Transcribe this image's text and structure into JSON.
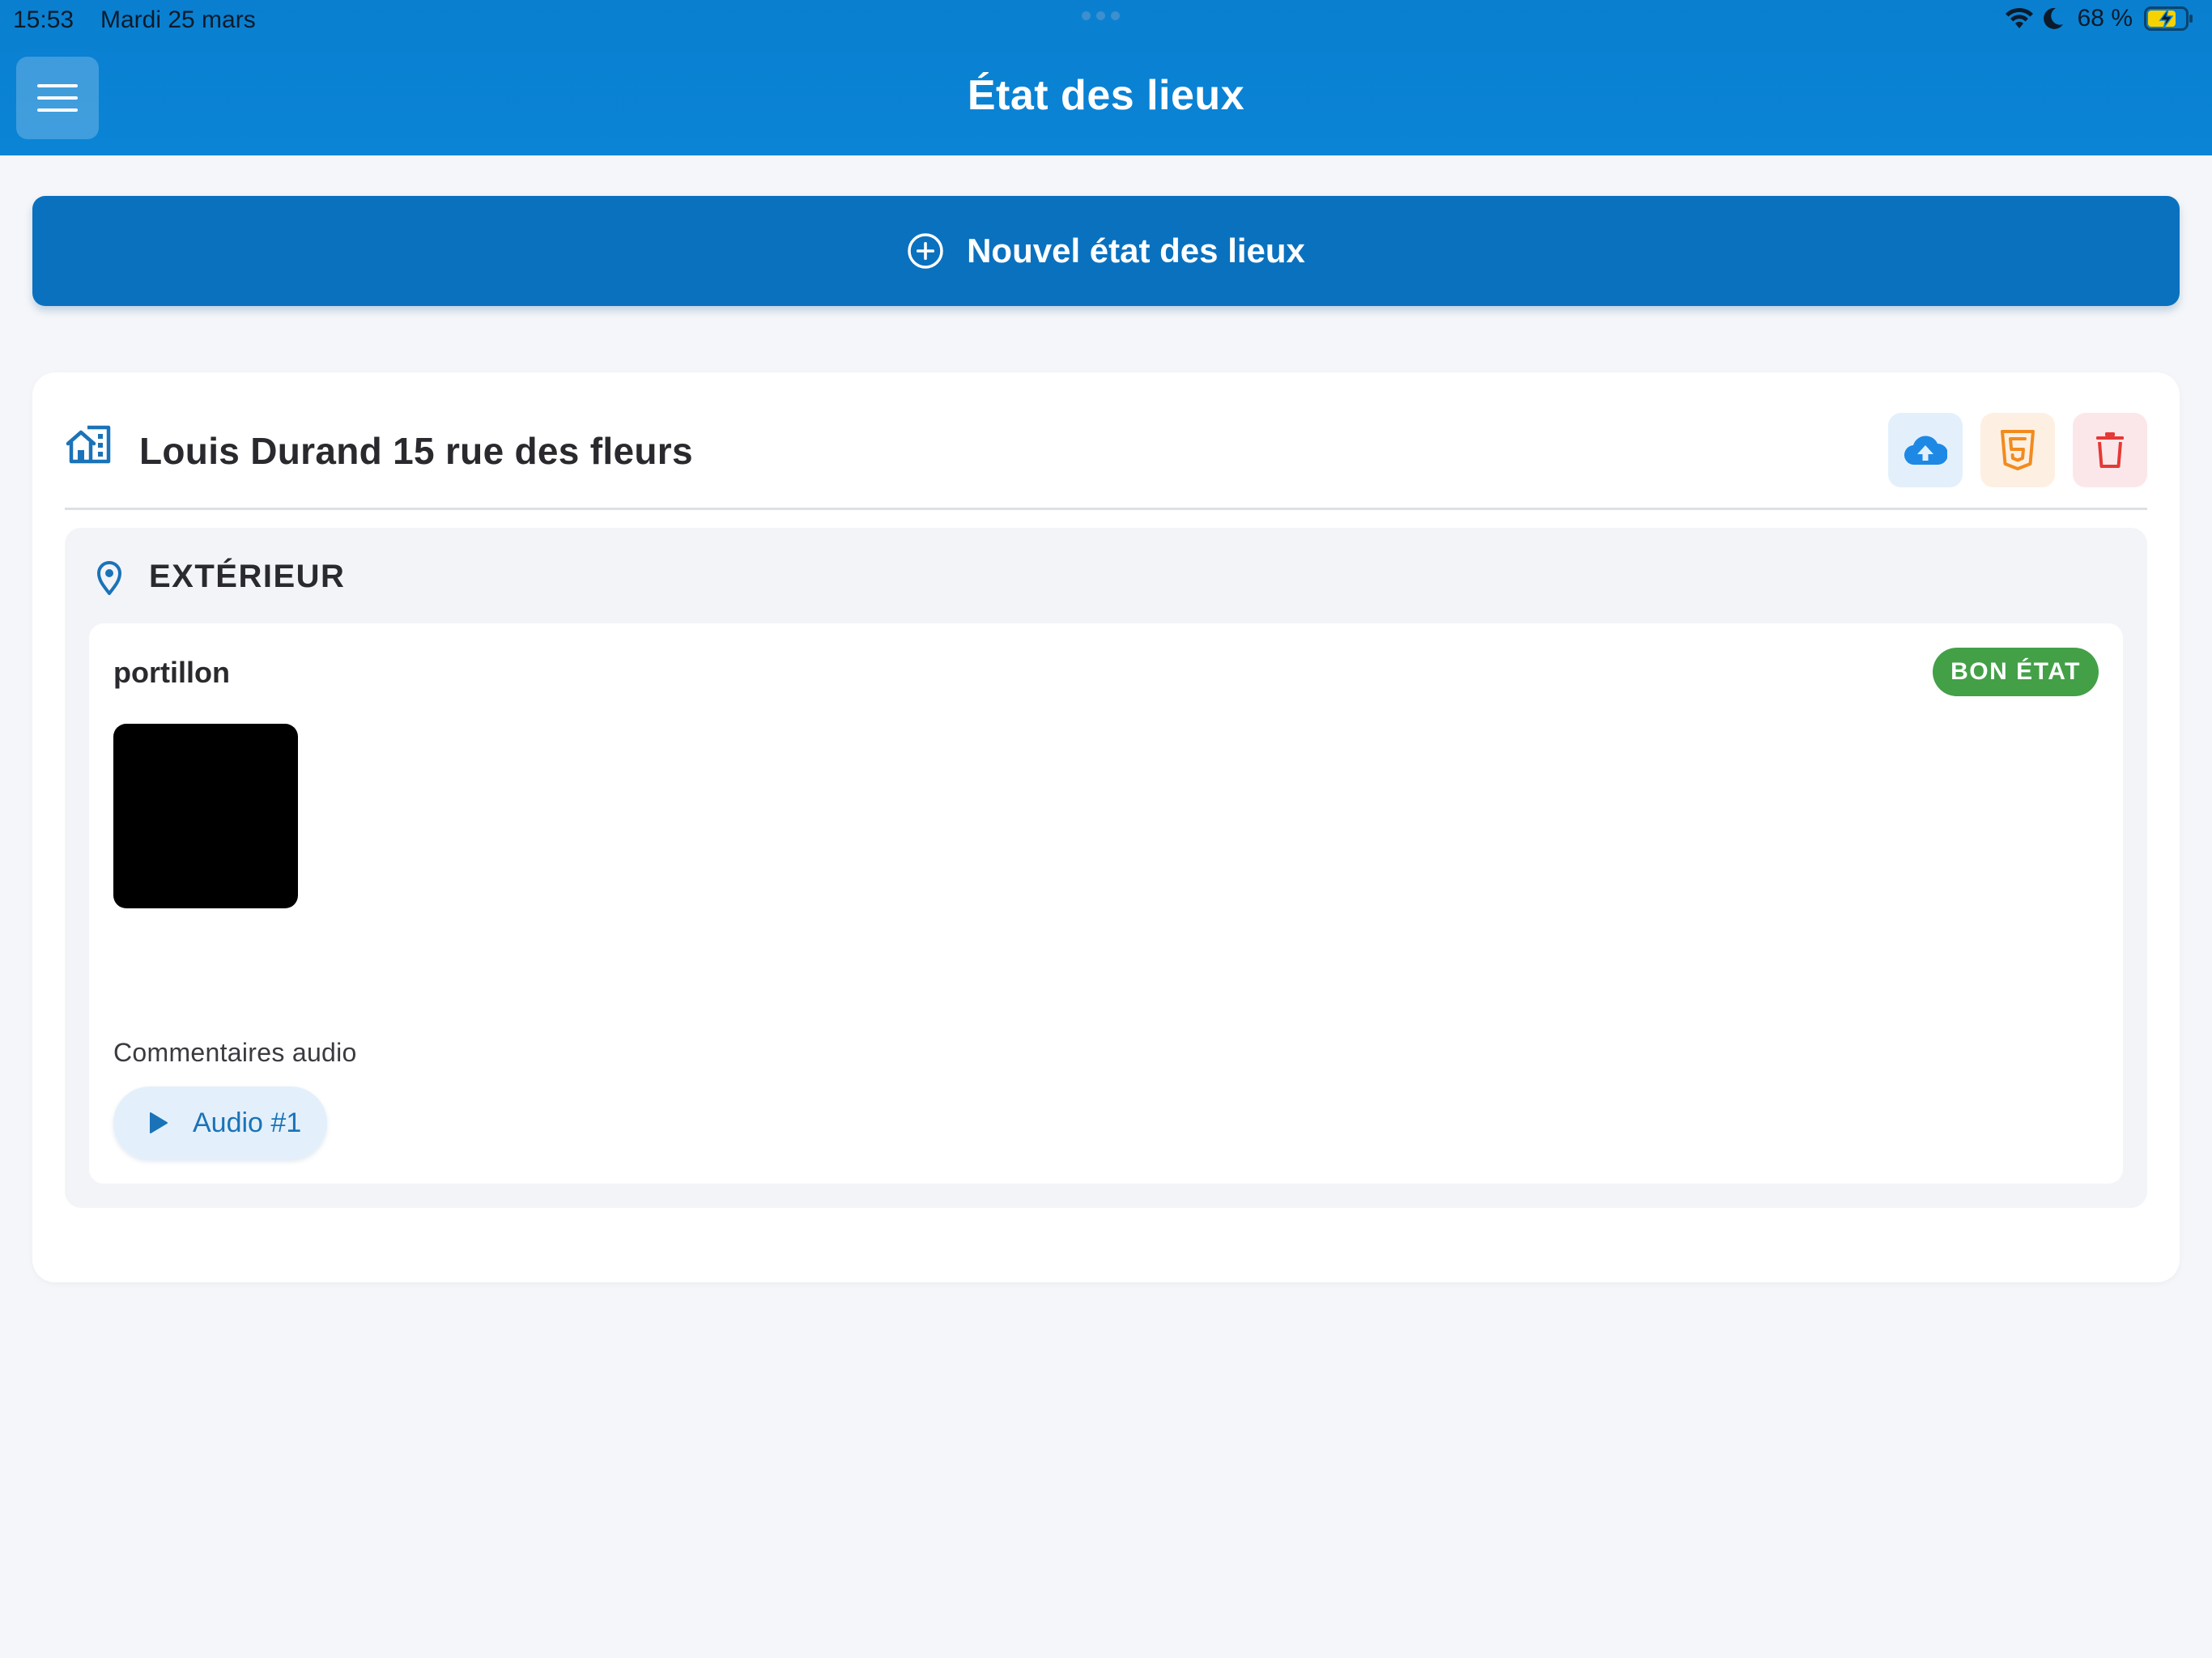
{
  "status_bar": {
    "time": "15:53",
    "date": "Mardi 25 mars",
    "battery_percent": "68 %",
    "wifi_icon": "wifi-icon",
    "focus_icon": "moon-icon",
    "battery_icon": "battery-charging-icon"
  },
  "header": {
    "title": "État des lieux",
    "menu_icon": "hamburger-menu-icon",
    "background_color": "#0b84d6"
  },
  "new_inspection": {
    "label": "Nouvel état des lieux",
    "icon": "plus-circle-icon",
    "background_color": "#0a71bf"
  },
  "inspection": {
    "title": "Louis Durand 15 rue des fleurs",
    "icon": "building-icon",
    "actions": [
      {
        "name": "upload",
        "icon": "cloud-upload-icon",
        "color": "#1e88e5"
      },
      {
        "name": "export-html",
        "icon": "html5-icon",
        "color": "#f28b1e"
      },
      {
        "name": "delete",
        "icon": "trash-icon",
        "color": "#e53935"
      }
    ],
    "rooms": [
      {
        "title": "EXTÉRIEUR",
        "icon": "location-pin-icon",
        "items": [
          {
            "name": "portillon",
            "condition": "BON ÉTAT",
            "condition_color": "#43a047",
            "photos_count": 1,
            "audio_section_label": "Commentaires audio",
            "audio_clips": [
              {
                "label": "Audio #1",
                "icon": "play-icon"
              }
            ]
          }
        ]
      }
    ]
  }
}
